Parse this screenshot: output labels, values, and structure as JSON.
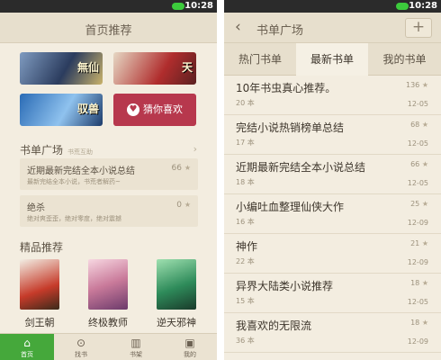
{
  "status": {
    "time": "10:28"
  },
  "left": {
    "title": "首页推荐",
    "covers": [
      {
        "label": "無仙"
      },
      {
        "label": "天"
      },
      {
        "label": "驭兽"
      }
    ],
    "guess_button": "猜你喜欢",
    "booklist_section": {
      "title": "书单广场",
      "subtitle": "书荒互助"
    },
    "booklists": [
      {
        "title": "近期最新完结全本小说总结",
        "count": "66",
        "desc": "最新完结全本小说，书荒者解药~"
      },
      {
        "title": "绝杀",
        "count": "0",
        "desc": "绝对爽歪歪，绝对零度，绝对震撼"
      }
    ],
    "picks_section": {
      "title": "精品推荐"
    },
    "picks": [
      {
        "title": "剑王朝"
      },
      {
        "title": "终极教师"
      },
      {
        "title": "逆天邪神"
      }
    ],
    "tabs": [
      {
        "label": "首页",
        "icon": "home-icon"
      },
      {
        "label": "找书",
        "icon": "search-icon"
      },
      {
        "label": "书架",
        "icon": "bookshelf-icon"
      },
      {
        "label": "我的",
        "icon": "profile-icon"
      }
    ]
  },
  "right": {
    "title": "书单广场",
    "tabs": [
      "热门书单",
      "最新书单",
      "我的书单"
    ],
    "rows": [
      {
        "title": "10年书虫真心推荐。",
        "books": "20 本",
        "count": "136",
        "date": "12-05"
      },
      {
        "title": "完结小说热销榜单总结",
        "books": "17 本",
        "count": "68",
        "date": "12-05"
      },
      {
        "title": "近期最新完结全本小说总结",
        "books": "18 本",
        "count": "66",
        "date": "12-05"
      },
      {
        "title": "小编吐血整理仙侠大作",
        "books": "16 本",
        "count": "25",
        "date": "12-09"
      },
      {
        "title": "神作",
        "books": "22 本",
        "count": "21",
        "date": "12-09"
      },
      {
        "title": "异界大陆类小说推荐",
        "books": "15 本",
        "count": "18",
        "date": "12-05"
      },
      {
        "title": "我喜欢的无限流",
        "books": "36 本",
        "count": "18",
        "date": "12-09"
      }
    ]
  }
}
